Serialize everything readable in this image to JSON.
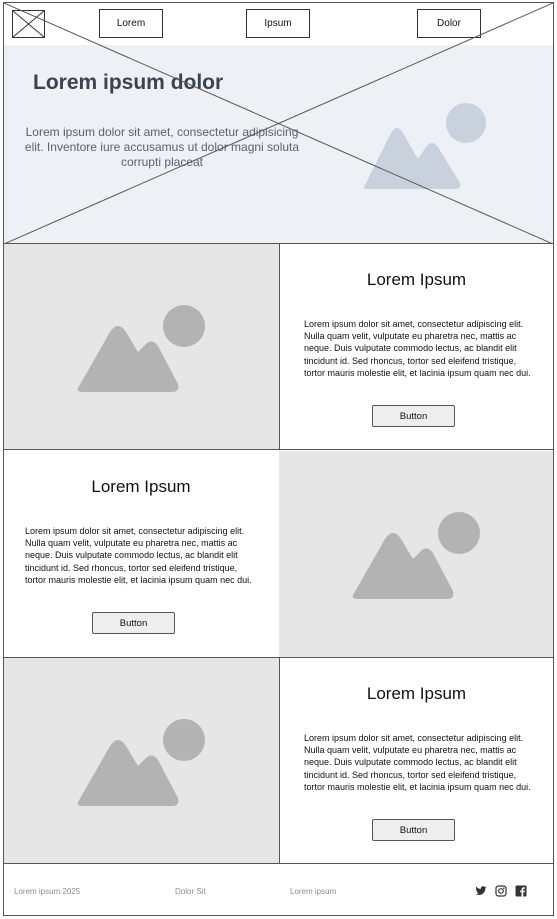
{
  "header": {
    "nav": [
      "Lorem",
      "Ipsum",
      "Dolor"
    ]
  },
  "hero": {
    "title": "Lorem ipsum dolor",
    "text": "Lorem ipsum dolor sit amet, consectetur adipisicing elit. Inventore iure accusamus ut dolor magni soluta corrupti placeat"
  },
  "features": [
    {
      "title": "Lorem Ipsum",
      "body": "Lorem ipsum dolor sit amet, consectetur adipiscing elit. Nulla quam velit, vulputate eu pharetra nec, mattis ac neque. Duis vulputate commodo lectus, ac blandit elit tincidunt id. Sed rhoncus, tortor sed eleifend tristique, tortor mauris molestie elit, et lacinia ipsum quam nec dui.",
      "button": "Button"
    },
    {
      "title": "Lorem Ipsum",
      "body": "Lorem ipsum dolor sit amet, consectetur adipiscing elit. Nulla quam velit, vulputate eu pharetra nec, mattis ac neque. Duis vulputate commodo lectus, ac blandit elit tincidunt id. Sed rhoncus, tortor sed eleifend tristique, tortor mauris molestie elit, et lacinia ipsum quam nec dui.",
      "button": "Button"
    },
    {
      "title": "Lorem Ipsum",
      "body": "Lorem ipsum dolor sit amet, consectetur adipiscing elit. Nulla quam velit, vulputate eu pharetra nec, mattis ac neque. Duis vulputate commodo lectus, ac blandit elit tincidunt id. Sed rhoncus, tortor sed eleifend tristique, tortor mauris molestie elit, et lacinia ipsum quam nec dui.",
      "button": "Button"
    }
  ],
  "footer": {
    "links": [
      "Lorem ipsum 2025",
      "Dolor Sit",
      "Lorem ipsum"
    ],
    "social_icons": [
      "twitter-icon",
      "instagram-icon",
      "facebook-icon"
    ]
  },
  "colors": {
    "hero_bg": "#edf0f4",
    "hero_title": "#3b4250",
    "placeholder_bg": "#e6e6e6",
    "placeholder_shape": "#b3b3b3",
    "hero_shape": "#c8d1dc",
    "footer_text": "#8d8d8d",
    "button_bg": "#eeeeee"
  }
}
